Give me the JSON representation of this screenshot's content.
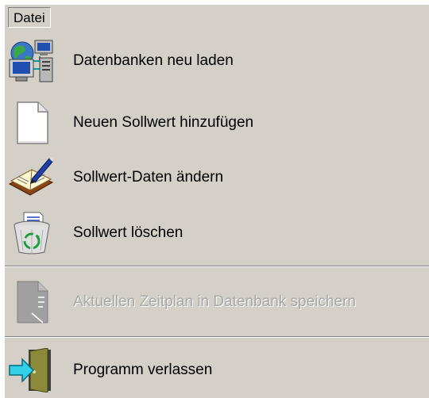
{
  "menubar": {
    "items": [
      {
        "label": "Datei"
      }
    ]
  },
  "menu": {
    "items": [
      {
        "label": "Datenbanken neu laden",
        "icon": "database-network-icon",
        "enabled": true
      },
      {
        "label": "Neuen Sollwert hinzufügen",
        "icon": "blank-document-icon",
        "enabled": true
      },
      {
        "label": "Sollwert-Daten ändern",
        "icon": "notebook-pen-icon",
        "enabled": true
      },
      {
        "label": "Sollwert löschen",
        "icon": "recycle-bin-icon",
        "enabled": true
      },
      {
        "label": "Aktuellen Zeitplan in Datenbank speichern",
        "icon": "save-to-database-icon",
        "enabled": false
      },
      {
        "label": "Programm verlassen",
        "icon": "exit-door-icon",
        "enabled": true
      }
    ]
  }
}
